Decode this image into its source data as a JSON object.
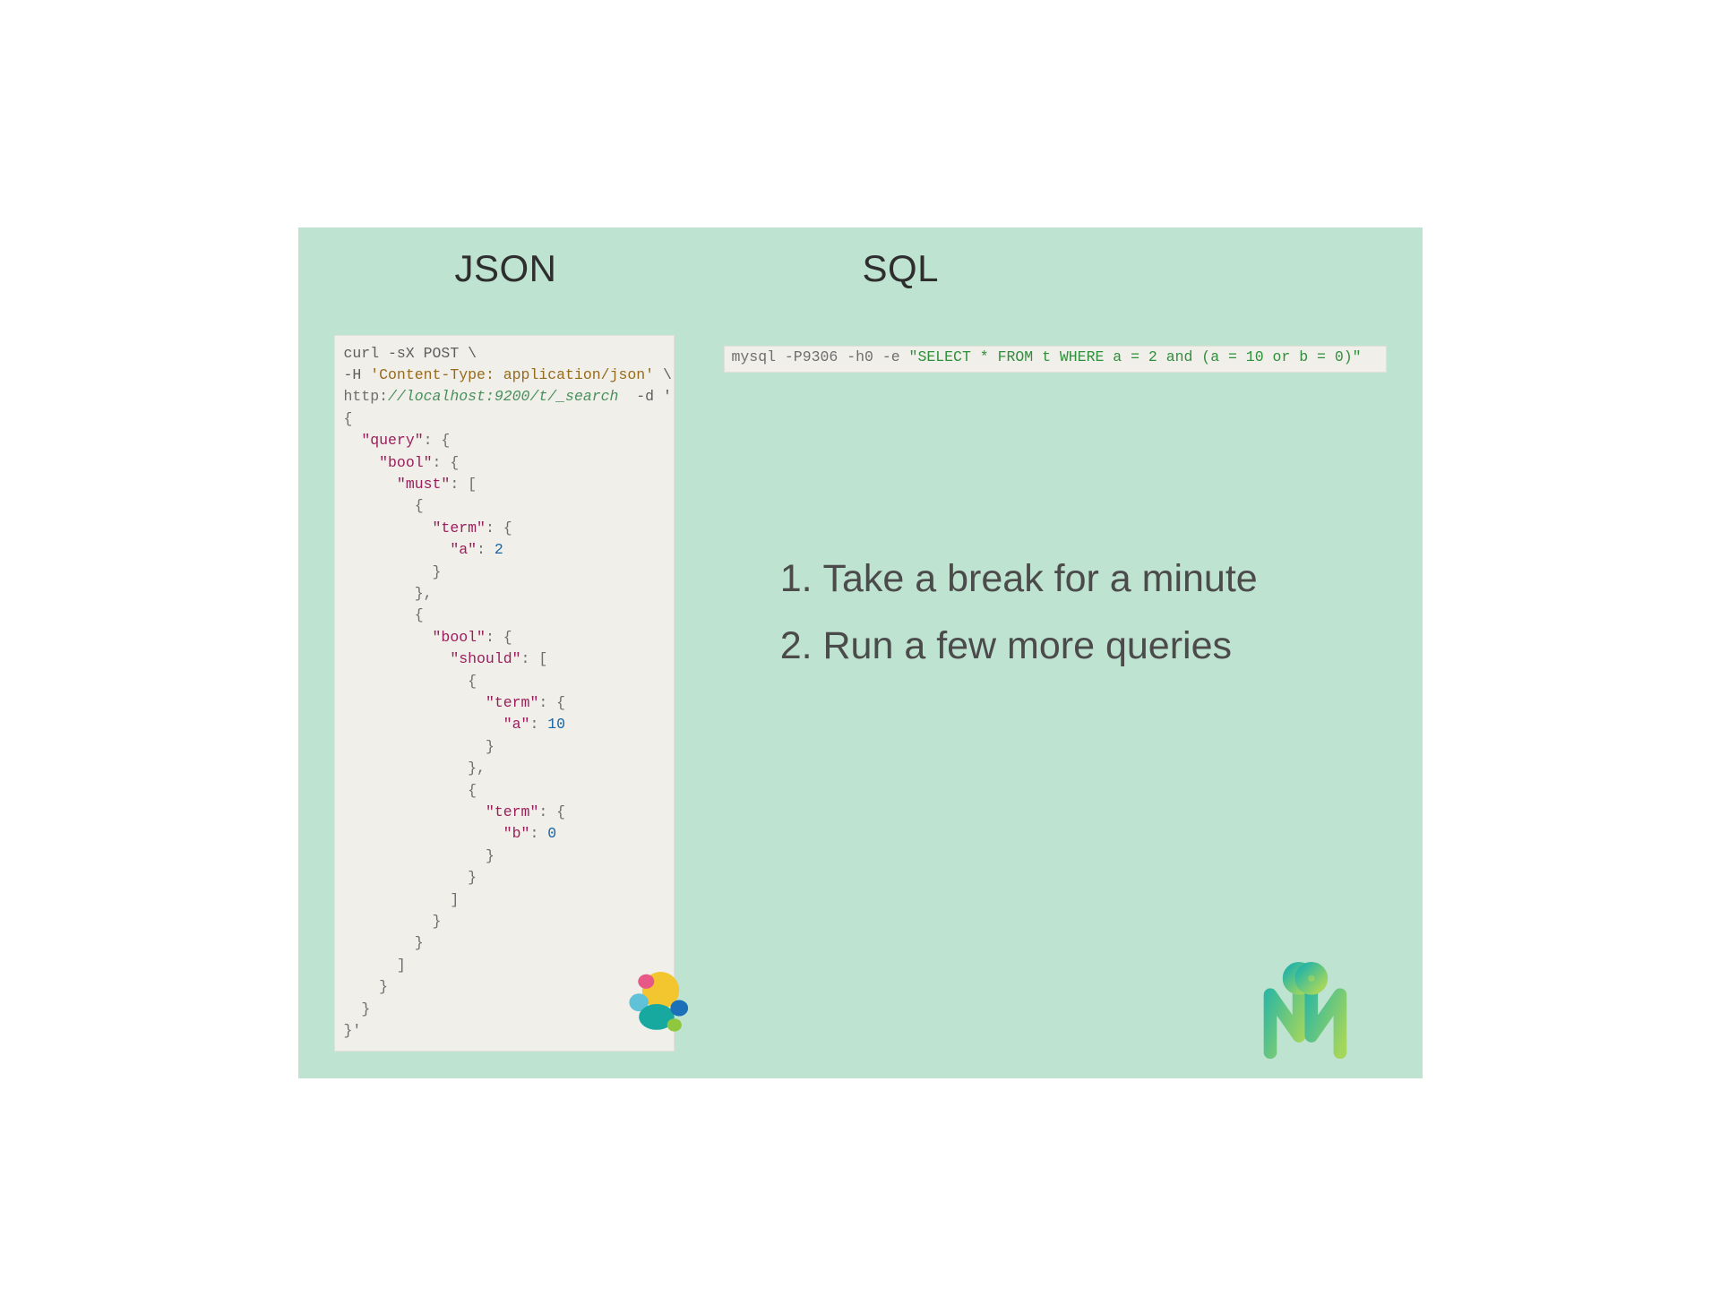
{
  "titles": {
    "json": "JSON",
    "sql": "SQL"
  },
  "json_code": {
    "cmd": "curl -sX POST \\",
    "hdr_pre": "-H ",
    "hdr": "'Content-Type: application/json'",
    "hdr_post": " \\",
    "url_scheme": "http:",
    "url_rest": "//localhost:9200/t/_search",
    "url_tail": "  -d '",
    "body_syntax_view": "see tokens below",
    "body_plain": "{\n  \"query\": {\n    \"bool\": {\n      \"must\": [\n        {\n          \"term\": {\n            \"a\": 2\n          }\n        },\n        {\n          \"bool\": {\n            \"should\": [\n              {\n                \"term\": {\n                  \"a\": 10\n                }\n              },\n              {\n                \"term\": {\n                  \"b\": 0\n                }\n              }\n            ]\n          }\n        }\n      ]\n    }\n  }\n}'",
    "indent": "  ",
    "keys": {
      "query": "\"query\"",
      "bool": "\"bool\"",
      "must": "\"must\"",
      "term": "\"term\"",
      "a": "\"a\"",
      "b": "\"b\"",
      "should": "\"should\""
    },
    "nums": {
      "two": "2",
      "ten": "10",
      "zero": "0"
    },
    "final_line": "}'"
  },
  "sql_code": {
    "pre": "mysql -P9306 -h0 -e ",
    "query": "\"SELECT * FROM t WHERE a = 2 and (a = 10 or b = 0)\""
  },
  "steps": {
    "items": [
      "Take a break for a minute",
      "Run a few more queries"
    ]
  },
  "logos": {
    "elastic": "elastic-logo",
    "manticore_m": "m-logo"
  }
}
